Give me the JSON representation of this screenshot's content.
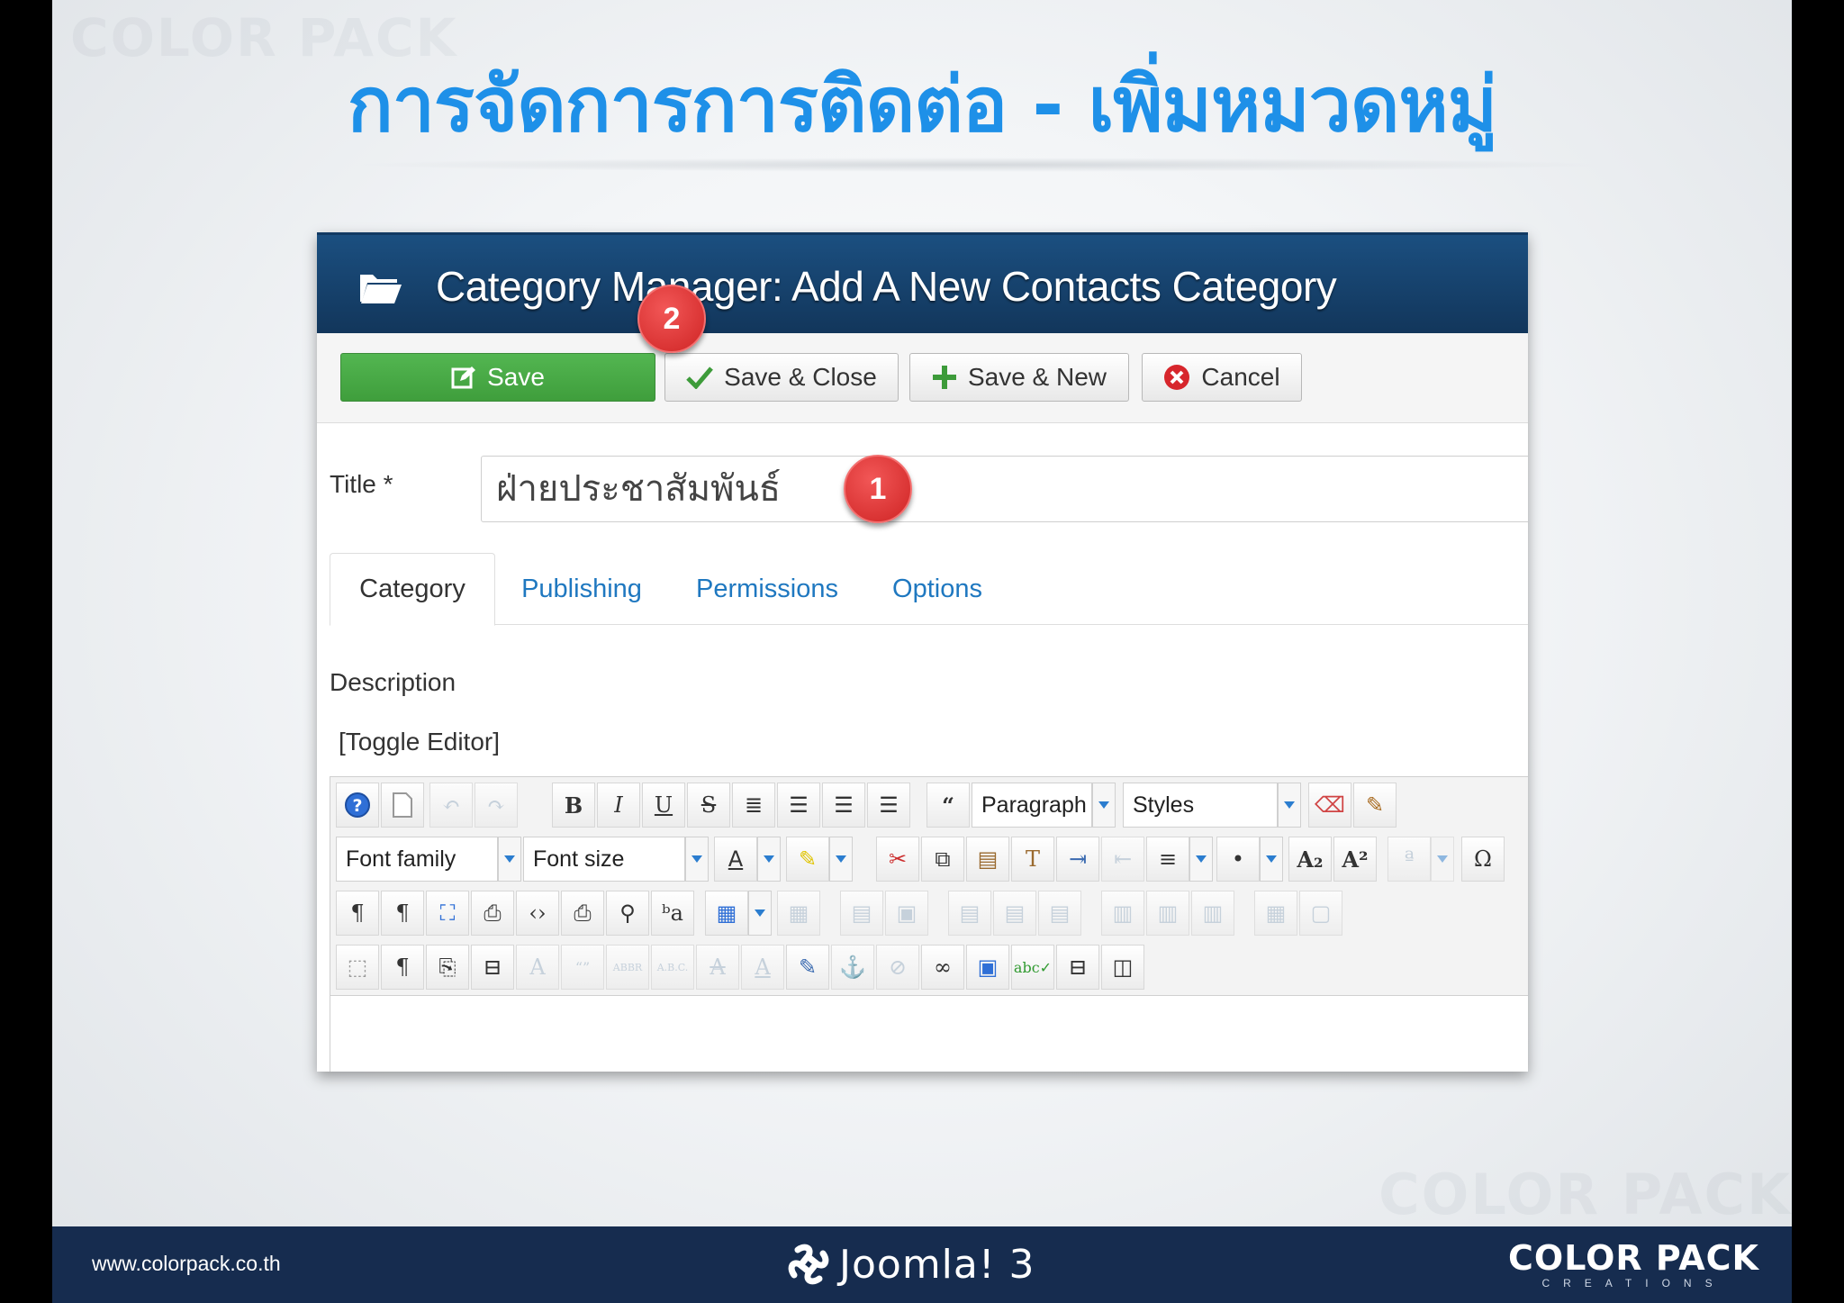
{
  "slide": {
    "title": "การจัดการการติดต่อ - เพิ่มหมวดหมู่",
    "watermark": "COLOR PACK"
  },
  "app": {
    "header_title": "Category Manager: Add A New Contacts Category",
    "toolbar": {
      "save": "Save",
      "save_close": "Save & Close",
      "save_new": "Save & New",
      "cancel": "Cancel"
    },
    "form": {
      "title_label": "Title *",
      "title_value": "ฝ่ายประชาสัมพันธ์",
      "tabs": [
        "Category",
        "Publishing",
        "Permissions",
        "Options"
      ],
      "active_tab": "Category",
      "description_label": "Description",
      "toggle_editor": "[Toggle Editor]"
    },
    "editor": {
      "format_select": "Paragraph",
      "styles_select": "Styles",
      "font_family_select": "Font family",
      "font_size_select": "Font size"
    },
    "callouts": [
      "2",
      "1"
    ]
  },
  "footer": {
    "url": "www.colorpack.co.th",
    "product": "Joomla! 3",
    "brand_top": "COLOR PACK",
    "brand_bottom": "CREATIONS"
  },
  "colors": {
    "title_blue": "#1e90e8",
    "header_navy": "#163f6a",
    "save_green": "#47a845",
    "badge_red": "#d92b2b",
    "link_blue": "#1f78c0",
    "footer_navy": "#162c4f"
  }
}
